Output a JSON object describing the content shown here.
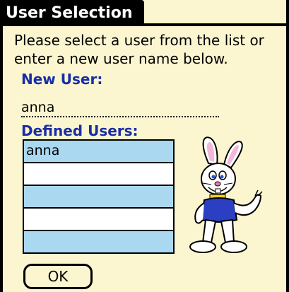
{
  "window": {
    "title": "User Selection"
  },
  "instructions": "Please select a user from the list or enter a new user name below.",
  "new_user": {
    "label": "New User:",
    "value": "anna"
  },
  "defined_users": {
    "label": "Defined Users:",
    "rows": [
      "anna",
      "",
      "",
      "",
      ""
    ]
  },
  "buttons": {
    "ok_label": "OK"
  },
  "colors": {
    "accent": "#1a2da6",
    "row_shade": "#a9d8f0",
    "background": "#fbf6d0"
  },
  "mascot_icon": "cartoon-rabbit-icon"
}
